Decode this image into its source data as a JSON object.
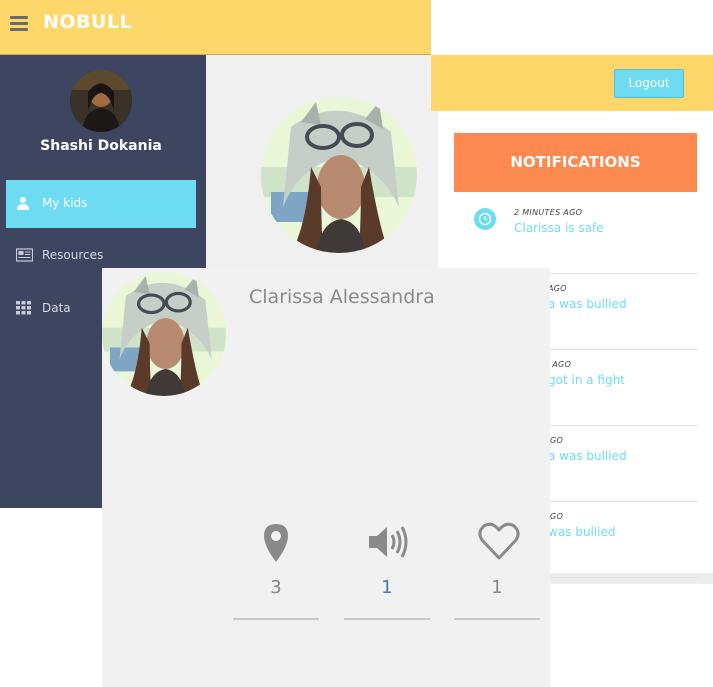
{
  "brand": "NOBULL",
  "user": {
    "name": "Shashi Dokania"
  },
  "sidebar": {
    "items": [
      {
        "label": "My kids",
        "icon": "user-icon",
        "active": true
      },
      {
        "label": "Resources",
        "icon": "newspaper-icon"
      },
      {
        "label": "Data",
        "icon": "grid-icon"
      }
    ]
  },
  "header": {
    "logout_label": "Logout"
  },
  "notifications": {
    "title": "NOTIFICATIONS",
    "items": [
      {
        "time": "2 MINUTES AGO",
        "message": "Clarissa is safe"
      },
      {
        "time": "AGO",
        "message": "a was bullied"
      },
      {
        "time": "S AGO",
        "message": "got in a fight"
      },
      {
        "time": "GO",
        "message": "a was bullied"
      },
      {
        "time": "GO",
        "message": "was bullied"
      }
    ]
  },
  "kid": {
    "name": "Clarissa Alessandra",
    "stats": {
      "location": {
        "icon": "location-pin-icon",
        "value": "3"
      },
      "bullied": {
        "icon": "speaker-icon",
        "value": "1"
      },
      "heart": {
        "icon": "heart-icon",
        "value": "1"
      }
    }
  },
  "colors": {
    "header_yellow": "#fdd76a",
    "sidebar_bg": "#3e4560",
    "accent_cyan": "#6ddcf2",
    "notif_orange": "#fc8a50",
    "link_blue": "#3b7dc0"
  }
}
